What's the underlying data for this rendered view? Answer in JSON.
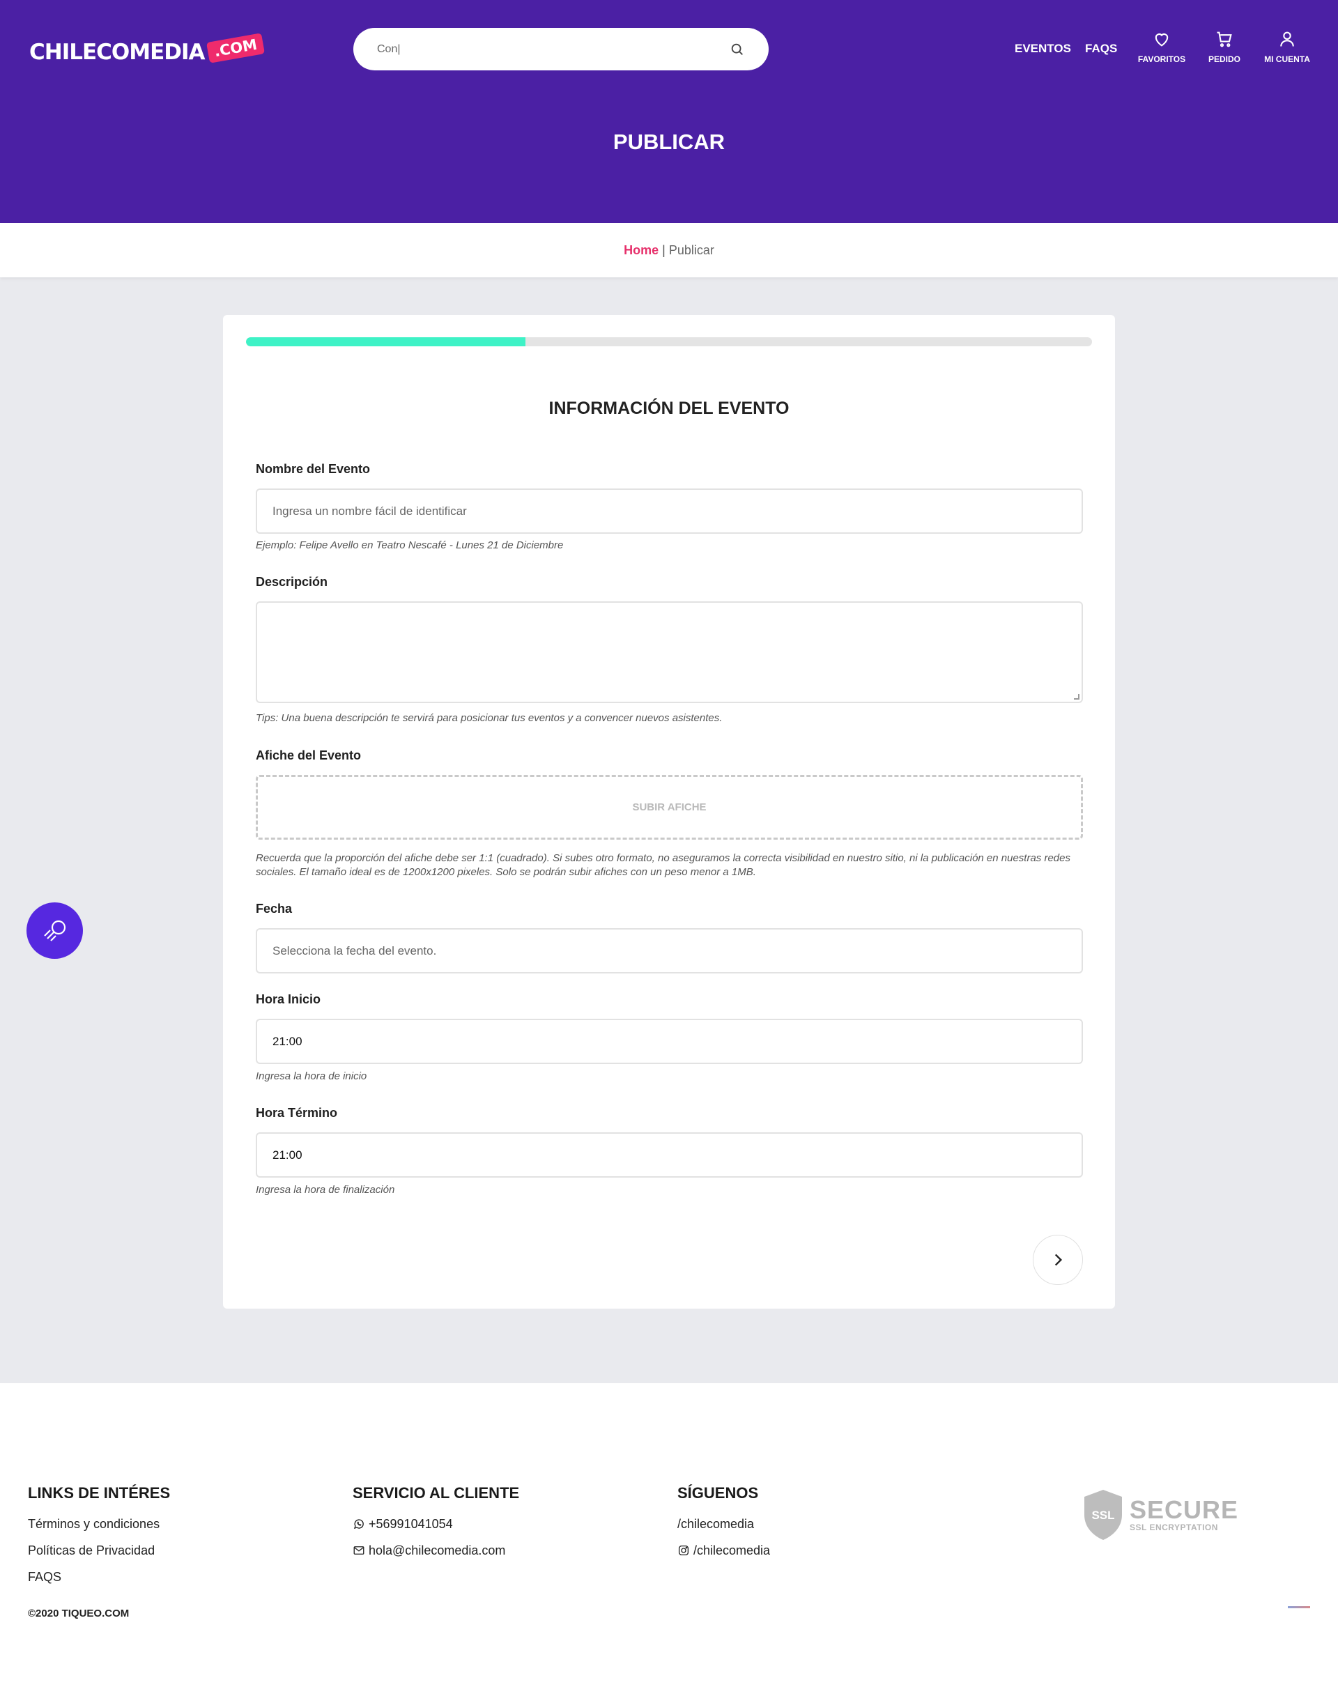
{
  "header": {
    "logo_text": "CHILECOMEDIA",
    "logo_tag": ".COM",
    "search_value": "Con|",
    "nav": {
      "eventos": "EVENTOS",
      "faqs": "FAQS",
      "favoritos": "FAVORITOS",
      "pedido": "PEDIDO",
      "mi_cuenta": "MI CUENTA"
    },
    "page_title": "PUBLICAR"
  },
  "breadcrumb": {
    "home": "Home",
    "separator": "|",
    "current": "Publicar"
  },
  "form": {
    "progress_fraction": 0.33,
    "section_title": "INFORMACIÓN DEL EVENTO",
    "nombre": {
      "label": "Nombre del Evento",
      "placeholder": "Ingresa un nombre fácil de identificar",
      "help": "Ejemplo: Felipe Avello en Teatro Nescafé - Lunes 21 de Diciembre"
    },
    "descripcion": {
      "label": "Descripción",
      "help": "Tips: Una buena descripción te servirá para posicionar tus eventos y a convencer nuevos asistentes."
    },
    "afiche": {
      "label": "Afiche del Evento",
      "button": "SUBIR AFICHE",
      "help": "Recuerda que la proporción del afiche debe ser 1:1 (cuadrado). Si subes otro formato, no aseguramos la correcta visibilidad en nuestro sitio, ni la publicación en nuestras redes sociales. El tamaño ideal es de 1200x1200 pixeles. Solo se podrán subir afiches con un peso menor a 1MB."
    },
    "fecha": {
      "label": "Fecha",
      "placeholder": "Selecciona la fecha del evento."
    },
    "hora_inicio": {
      "label": "Hora Inicio",
      "value": "21:00",
      "help": "Ingresa la hora de inicio"
    },
    "hora_termino": {
      "label": "Hora Término",
      "value": "21:00",
      "help": "Ingresa la hora de finalización"
    }
  },
  "footer": {
    "links_heading": "LINKS DE INTÉRES",
    "links": [
      "Términos y condiciones",
      "Políticas de Privacidad",
      "FAQS"
    ],
    "service_heading": "SERVICIO AL CLIENTE",
    "phone": "+56991041054",
    "email": "hola@chilecomedia.com",
    "social_heading": "SÍGUENOS",
    "facebook": "/chilecomedia",
    "instagram": "/chilecomedia",
    "copyright": "©2020 TIQUEO.COM",
    "ssl_label": "SSL",
    "ssl_big": "SECURE",
    "ssl_small": "SSL ENCRYPTATION"
  },
  "colors": {
    "header_bg": "#4b20a4",
    "accent_pink": "#e6306b",
    "progress": "#3ef2c6",
    "float_button": "#5628e0"
  },
  "icons": [
    "search-icon",
    "heart-icon",
    "cart-icon",
    "user-icon",
    "chevron-right-icon",
    "search-assistant-icon",
    "whatsapp-icon",
    "mail-icon",
    "instagram-icon",
    "ssl-shield-icon"
  ]
}
